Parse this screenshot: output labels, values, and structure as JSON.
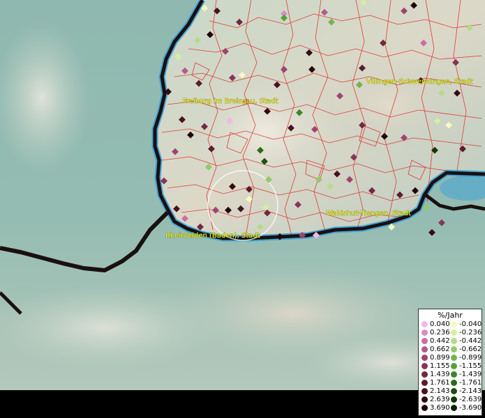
{
  "labels": {
    "freiburg": "Freiburg im Breisgau, Stadt",
    "villingen": "Villingen-Schwenningen, Stadt",
    "waldshut": "Waldshut-Tiengen, Stadt",
    "rheinfelden": "Rheinfelden (Baden), Stadt"
  },
  "legend": {
    "title": "%/Jahr",
    "positive": [
      {
        "value": "0.040",
        "color": "#f0b8e8"
      },
      {
        "value": "0.236",
        "color": "#dc8cc4"
      },
      {
        "value": "0.442",
        "color": "#c86ea6"
      },
      {
        "value": "0.662",
        "color": "#b45a8a"
      },
      {
        "value": "0.899",
        "color": "#9e4470"
      },
      {
        "value": "1.155",
        "color": "#883458"
      },
      {
        "value": "1.439",
        "color": "#722840"
      },
      {
        "value": "1.761",
        "color": "#5c1c2e"
      },
      {
        "value": "2.143",
        "color": "#48121e"
      },
      {
        "value": "2.639",
        "color": "#340a12"
      },
      {
        "value": "3.690",
        "color": "#200408"
      }
    ],
    "negative": [
      {
        "value": "-0.040",
        "color": "#f2fcc0"
      },
      {
        "value": "-0.236",
        "color": "#d4eea4"
      },
      {
        "value": "-0.442",
        "color": "#b4dc88"
      },
      {
        "value": "-0.662",
        "color": "#94c86c"
      },
      {
        "value": "-0.899",
        "color": "#74b452"
      },
      {
        "value": "-1.155",
        "color": "#56a03a"
      },
      {
        "value": "-1.439",
        "color": "#3c8628"
      },
      {
        "value": "-1.761",
        "color": "#286c1a"
      },
      {
        "value": "-2.143",
        "color": "#1a520e"
      },
      {
        "value": "-2.639",
        "color": "#0e3806"
      },
      {
        "value": "-3.690",
        "color": "#062004"
      }
    ]
  },
  "colors": {
    "water": "#6fa8a8",
    "lake_blue": "#3aa0d8",
    "border": "#1a1010",
    "boundary": "#e02020",
    "label": "#ffff00"
  }
}
